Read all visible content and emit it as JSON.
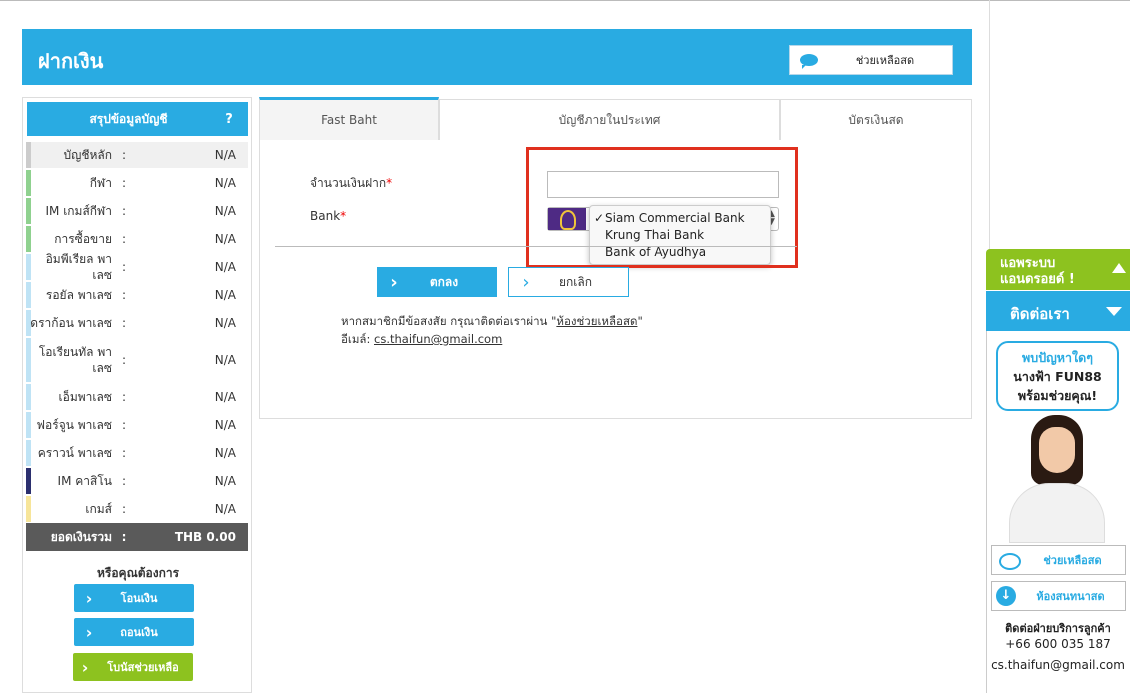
{
  "header": {
    "title": "ฝากเงิน",
    "chat_label": "ช่วยเหลือสด"
  },
  "sidebar": {
    "title": "สรุปข้อมูลบัญชี",
    "help": "?",
    "accounts": [
      {
        "name": "บัญชีหลัก",
        "value": "N/A",
        "color": "#cccccc"
      },
      {
        "name": "กีฬา",
        "value": "N/A",
        "color": "#8fd18f"
      },
      {
        "name": "IM เกมส์กีฬา",
        "value": "N/A",
        "color": "#8fd18f"
      },
      {
        "name": "การซื้อขาย",
        "value": "N/A",
        "color": "#8fd18f"
      },
      {
        "name": "อิมพีเรียล พาเลซ",
        "value": "N/A",
        "color": "#bfe3f5"
      },
      {
        "name": "รอยัล พาเลซ",
        "value": "N/A",
        "color": "#bfe3f5"
      },
      {
        "name": "ดราก้อน พาเลซ",
        "value": "N/A",
        "color": "#bfe3f5"
      },
      {
        "name": "โอเรียนทัล พาเลซ",
        "value": "N/A",
        "color": "#bfe3f5"
      },
      {
        "name": "เอ็มพาเลซ",
        "value": "N/A",
        "color": "#bfe3f5"
      },
      {
        "name": "ฟอร์จูน พาเลซ",
        "value": "N/A",
        "color": "#bfe3f5"
      },
      {
        "name": "คราวน์ พาเลซ",
        "value": "N/A",
        "color": "#bfe3f5"
      },
      {
        "name": "IM คาสิโน",
        "value": "N/A",
        "color": "#2b2f6e"
      },
      {
        "name": "เกมส์",
        "value": "N/A",
        "color": "#f7e59a"
      }
    ],
    "total_label": "ยอดเงินรวม",
    "total_value": "THB 0.00",
    "colon": ":",
    "choose_label": "หรือคุณต้องการ",
    "transfer_label": "โอนเงิน",
    "withdraw_label": "ถอนเงิน",
    "bonus_label": "โบนัสช่วยเหลือ"
  },
  "tabs": [
    "Fast Baht",
    "บัญชีภายในประเทศ",
    "บัตรเงินสด"
  ],
  "form": {
    "amount_label": "จำนวนเงินฝาก",
    "bank_label": "Bank",
    "required_mark": "*",
    "amount_value": "",
    "bank_options": [
      "Siam Commercial Bank",
      "Krung Thai Bank",
      "Bank of Ayudhya"
    ],
    "selected_mark": "✓",
    "submit_label": "ตกลง",
    "cancel_label": "ยกเลิก",
    "help_text": "หากสมาชิกมีข้อสงสัย กรุณาติดต่อเราผ่าน \"",
    "help_link": "ห้องช่วยเหลือสด",
    "help_end": "\"",
    "email_label": "อีเมล์: ",
    "email_value": "cs.thaifun@gmail.com"
  },
  "right_panel": {
    "android_line1": "แอพระบบ",
    "android_line2": "แอนดรอยด์ !",
    "contact_title": "ติดต่อเรา",
    "speech_line1": "พบปัญหาใดๆ",
    "speech_line2": "นางฟ้า FUN88",
    "speech_line3": "พร้อมช่วยคุณ!",
    "live_help": "ช่วยเหลือสด",
    "chat_room": "ห้องสนทนาสด",
    "cs_title": "ติดต่อฝ่ายบริการลูกค้า",
    "cs_phone": "+66 600 035 187",
    "cs_email": "cs.thaifun@gmail.com"
  }
}
